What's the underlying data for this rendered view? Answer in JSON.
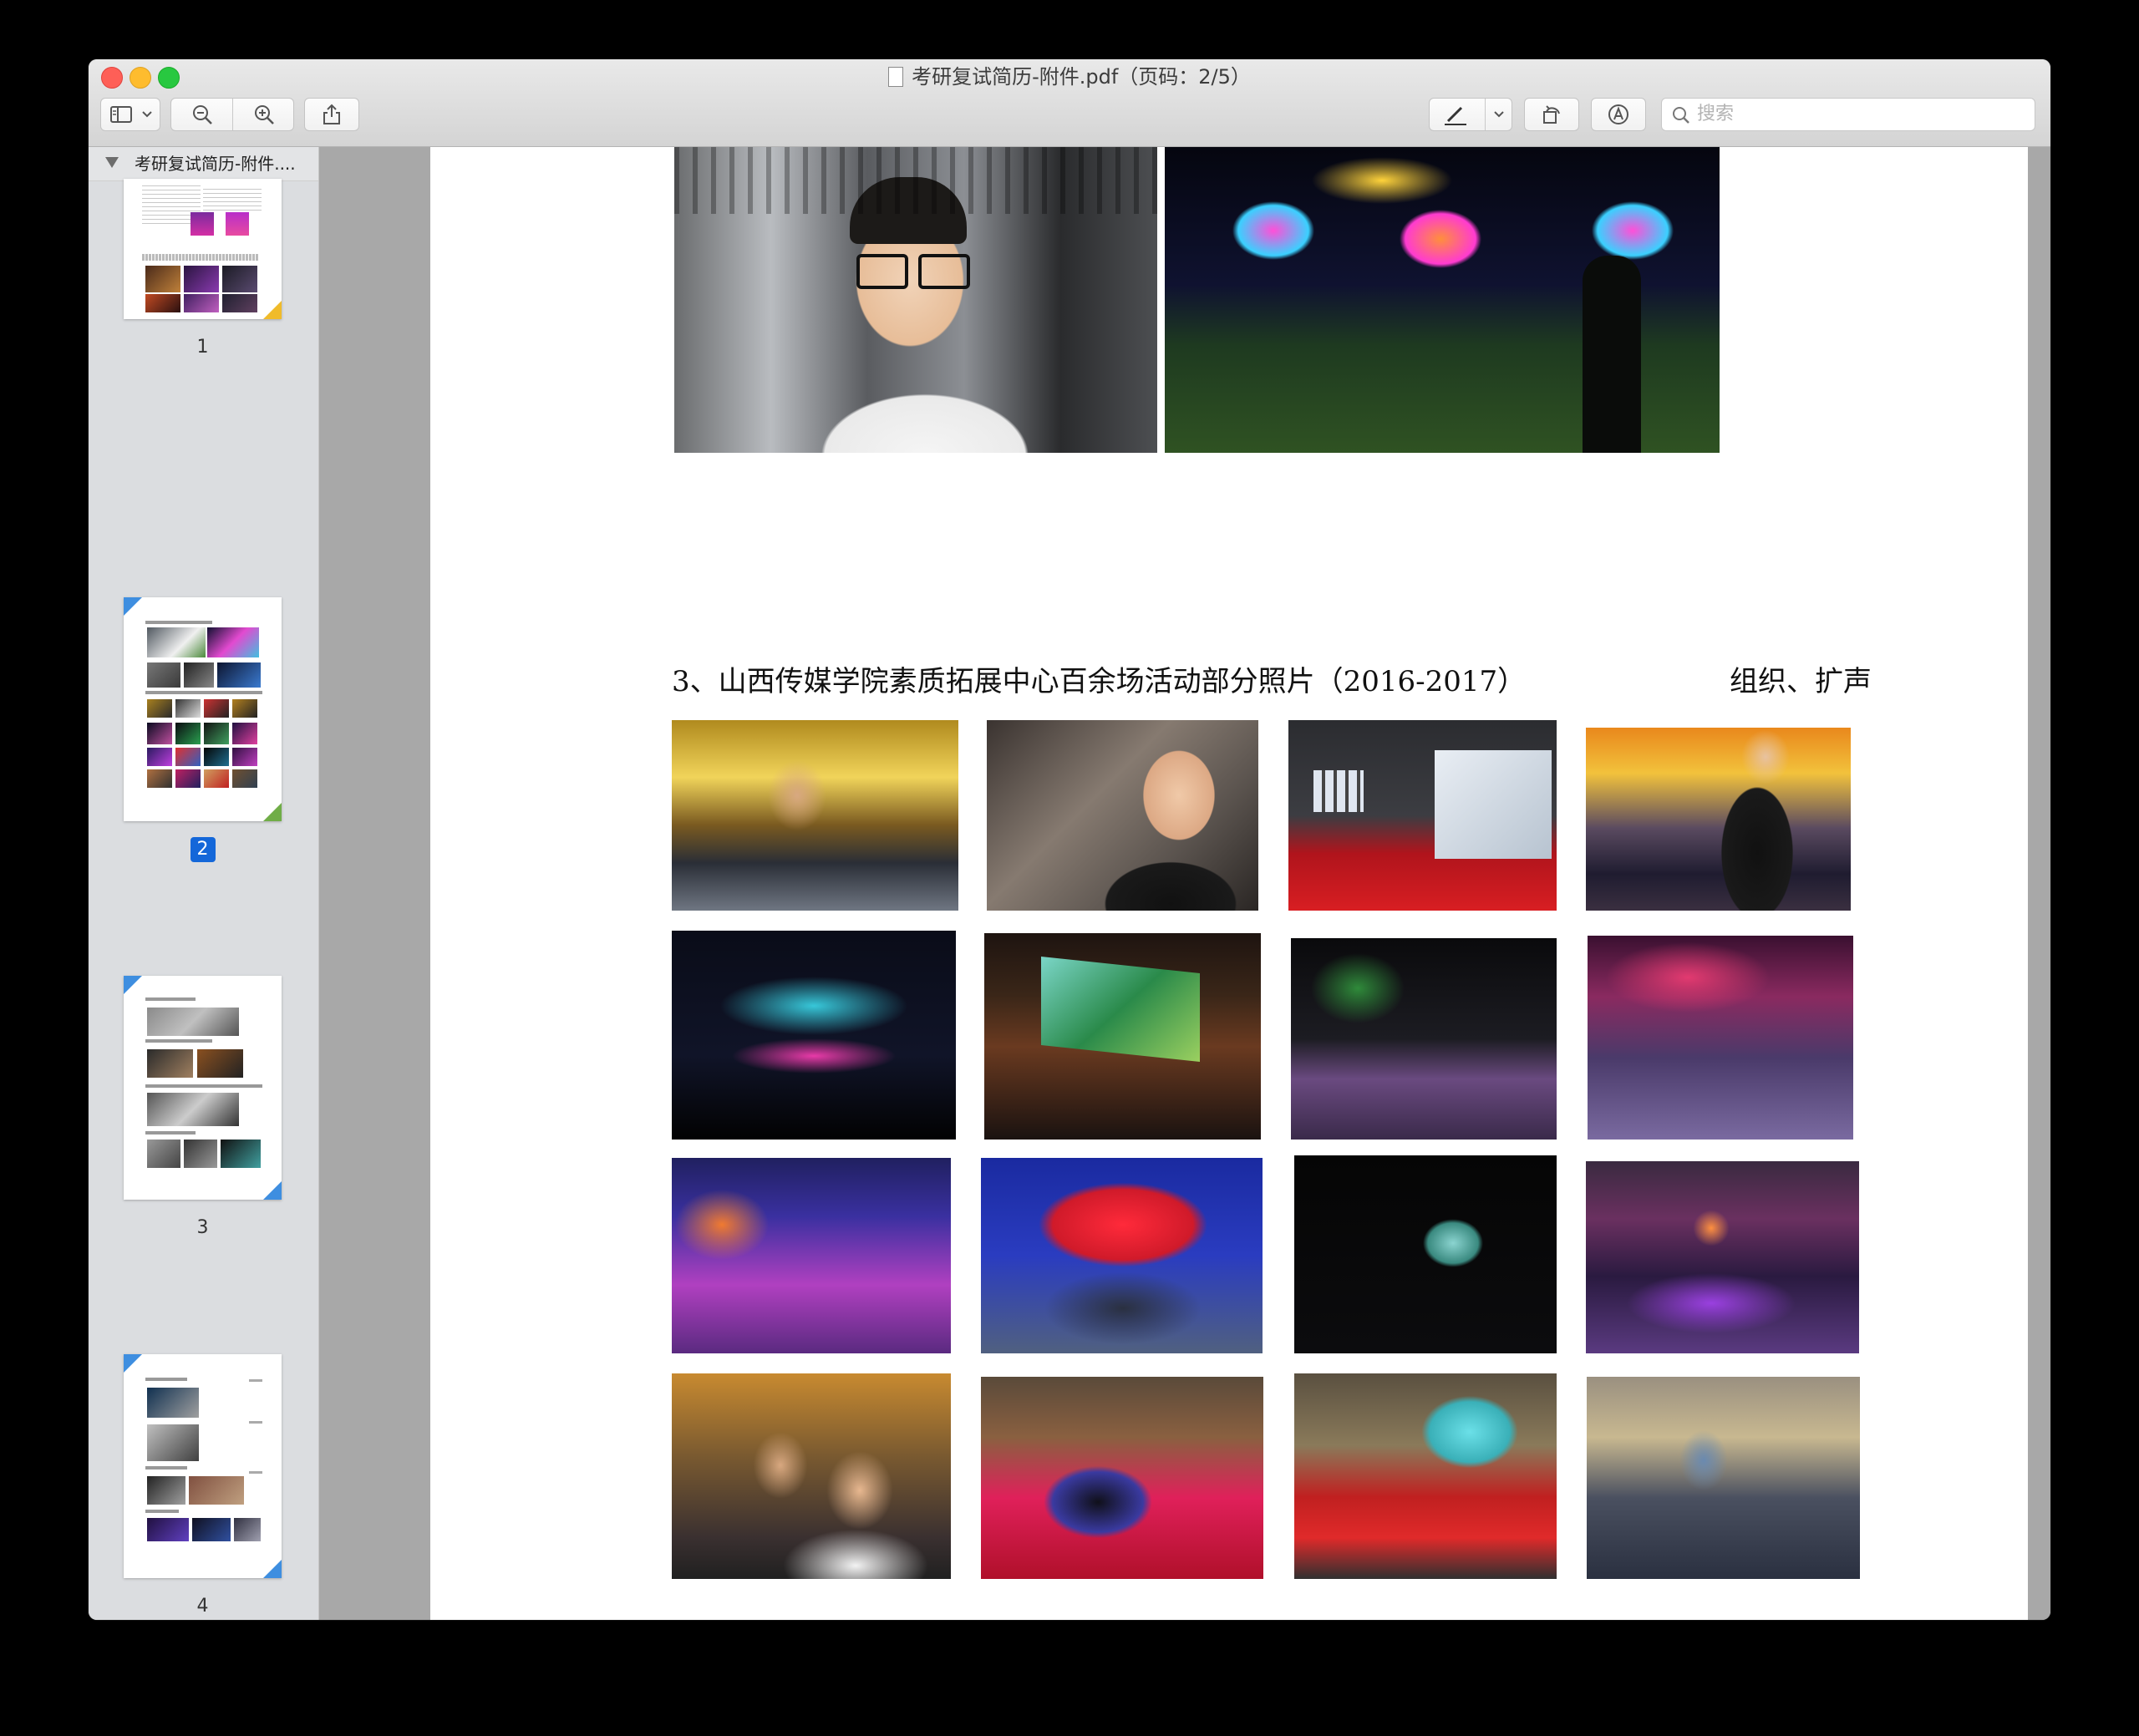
{
  "window": {
    "title": "考研复试简历-附件.pdf（页码：2/5）",
    "search_placeholder": "搜索"
  },
  "sidebar": {
    "document_label": "考研复试简历-附件....",
    "pages": [
      {
        "label": "1"
      },
      {
        "label": "2",
        "selected": true
      },
      {
        "label": "3"
      },
      {
        "label": "4"
      }
    ]
  },
  "page": {
    "heading": "3、山西传媒学院素质拓展中心百余场活动部分照片（2016-2017）",
    "heading_right": "组织、扩声"
  },
  "colors": {
    "accent": "#1467d9",
    "corner_green": "#70ad47",
    "corner_blue": "#3e8ee0",
    "corner_yellow": "#f0bb2a"
  },
  "icons": [
    "sidebar-toggle-icon",
    "chevron-down-icon",
    "zoom-out-icon",
    "zoom-in-icon",
    "share-icon",
    "markup-pen-icon",
    "rotate-icon",
    "annotate-icon",
    "search-icon",
    "document-icon"
  ]
}
